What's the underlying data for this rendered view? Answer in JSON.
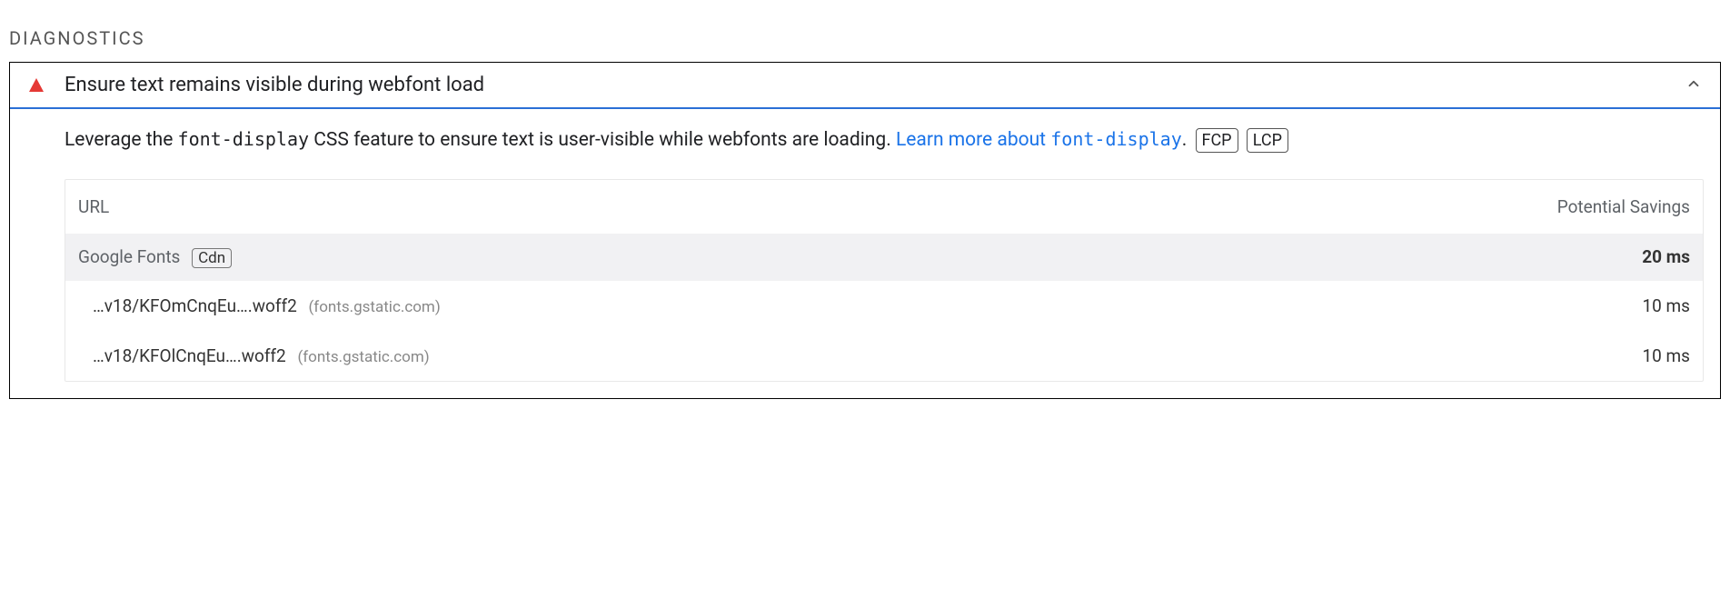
{
  "section_title": "DIAGNOSTICS",
  "audit": {
    "title": "Ensure text remains visible during webfont load",
    "description_prefix": "Leverage the ",
    "description_code": "font-display",
    "description_mid": " CSS feature to ensure text is user-visible while webfonts are loading. ",
    "link_text_pre": "Learn more about ",
    "link_code": "font-display",
    "description_suffix": ". ",
    "metric_tags": [
      "FCP",
      "LCP"
    ]
  },
  "table": {
    "col_url": "URL",
    "col_savings": "Potential Savings",
    "group": {
      "label": "Google Fonts",
      "tag": "Cdn",
      "savings": "20 ms"
    },
    "rows": [
      {
        "path": "…v18/KFOmCnqEu….woff2",
        "host": "(fonts.gstatic.com)",
        "savings": "10 ms"
      },
      {
        "path": "…v18/KFOlCnqEu….woff2",
        "host": "(fonts.gstatic.com)",
        "savings": "10 ms"
      }
    ]
  }
}
